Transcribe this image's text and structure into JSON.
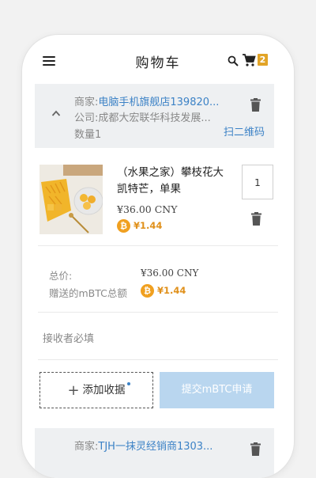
{
  "header": {
    "title": "购物车",
    "cart_count": "2"
  },
  "shops": [
    {
      "merchant_label": "商家:",
      "merchant_name": "电脑手机旗舰店139820...",
      "company_label": "公司:",
      "company_name": "成都大宏联华科技发展...",
      "quantity_text": "数量1",
      "qr_label": "扫二维码"
    },
    {
      "merchant_label": "商家:",
      "merchant_name": "TJH一抹灵经销商1303..."
    }
  ],
  "product": {
    "name": "（水果之家）攀枝花大凯特芒，单果",
    "price": "¥36.00 CNY",
    "mbtc": "¥1.44",
    "quantity": "1"
  },
  "summary": {
    "total_label": "总价:",
    "total_value": "¥36.00 CNY",
    "mbtc_label": "赠送的mBTC总额",
    "mbtc_value": "¥1.44"
  },
  "receiver_placeholder": "接收者必填",
  "buttons": {
    "add_receiver": "添加收据",
    "submit": "提交mBTC申请"
  },
  "icons": {
    "coin_symbol": "₿"
  },
  "colors": {
    "link": "#3c82c6",
    "badge": "#e2a427",
    "coin": "#f0a020",
    "submit_bg": "#b9d6ef"
  }
}
